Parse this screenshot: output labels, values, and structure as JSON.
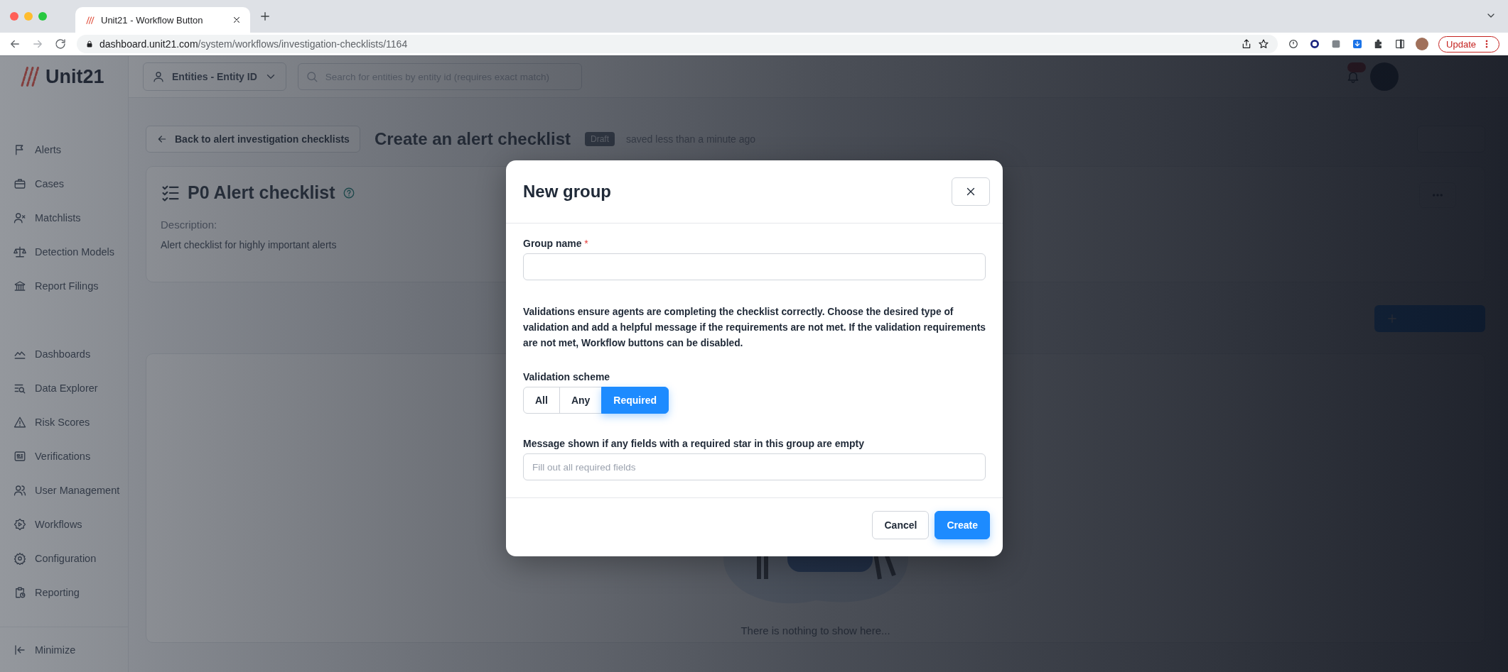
{
  "browser": {
    "tab_title": "Unit21 - Workflow Button",
    "url_host": "dashboard.unit21.com",
    "url_path": "/system/workflows/investigation-checklists/1164",
    "update_label": "Update"
  },
  "app": {
    "logo_text": "Unit21",
    "entity_selector": "Entities - Entity ID",
    "search_placeholder": "Search for entities by entity id (requires exact match)",
    "nav_groups": [
      [
        {
          "label": "Alerts"
        },
        {
          "label": "Cases"
        },
        {
          "label": "Matchlists"
        },
        {
          "label": "Detection Models"
        },
        {
          "label": "Report Filings"
        }
      ],
      [
        {
          "label": "Dashboards"
        },
        {
          "label": "Data Explorer"
        },
        {
          "label": "Risk Scores"
        },
        {
          "label": "Verifications"
        },
        {
          "label": "User Management"
        },
        {
          "label": "Workflows"
        },
        {
          "label": "Configuration"
        },
        {
          "label": "Reporting"
        }
      ]
    ],
    "minimize_label": "Minimize"
  },
  "page": {
    "back_button": "Back to alert investigation checklists",
    "title": "Create an alert checklist",
    "status_badge": "Draft",
    "saved_text": "saved less than a minute ago",
    "checklist": {
      "title": "P0 Alert checklist",
      "description_label": "Description:",
      "description": "Alert checklist for highly important alerts"
    },
    "empty_text": "There is nothing to show here..."
  },
  "modal": {
    "title": "New group",
    "group_name": {
      "label": "Group name",
      "required_mark": "*"
    },
    "help_text": "Validations ensure agents are completing the checklist correctly. Choose the desired type of validation and add a helpful message if the requirements are not met. If the validation requirements are not met, Workflow buttons can be disabled.",
    "scheme_label": "Validation scheme",
    "scheme_options": [
      {
        "label": "All",
        "selected": false
      },
      {
        "label": "Any",
        "selected": false
      },
      {
        "label": "Required",
        "selected": true
      }
    ],
    "message_label": "Message shown if any fields with a required star in this group are empty",
    "message_placeholder": "Fill out all required fields",
    "cancel_button": "Cancel",
    "create_button": "Create"
  }
}
